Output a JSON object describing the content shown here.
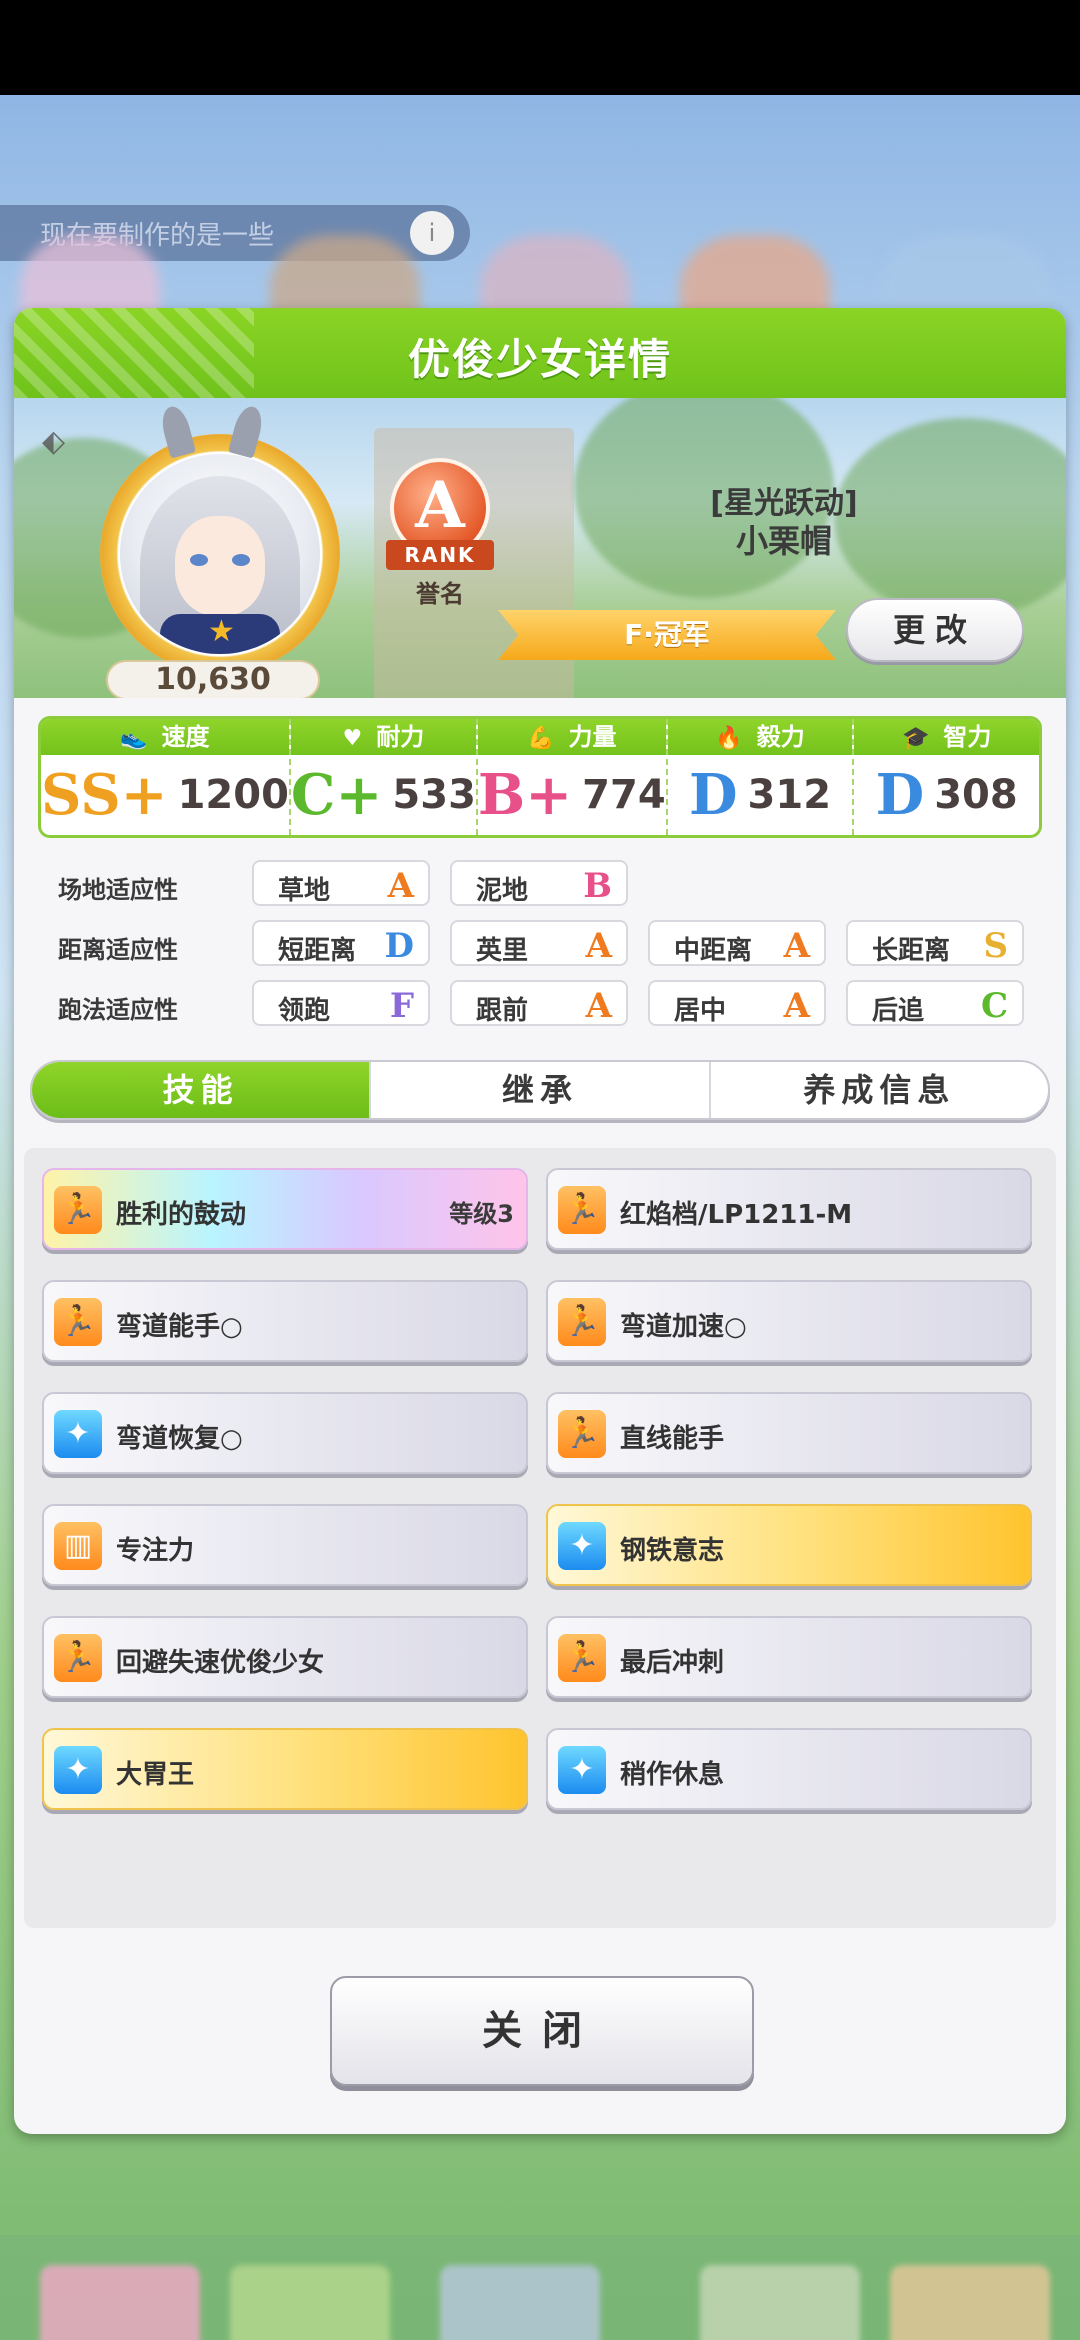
{
  "background": {
    "topbar_text": "现在要制作的是一些",
    "topbar_button": "i"
  },
  "modal": {
    "title": "优俊少女详情",
    "fan_count": "10,630",
    "rank": {
      "letter": "A",
      "ribbon": "RANK",
      "caption": "誉名"
    },
    "epithet": "[星光跃动]",
    "trainer_name": "小栗帽",
    "title_banner": "F·冠军",
    "change_button": "更改",
    "stats": [
      {
        "label": "速度",
        "icon": "shoe-icon",
        "grade": "SS+",
        "value": "1200",
        "color": "#f0a020"
      },
      {
        "label": "耐力",
        "icon": "heart-icon",
        "grade": "C+",
        "value": "533",
        "color": "#5cb82c"
      },
      {
        "label": "力量",
        "icon": "muscle-icon",
        "grade": "B+",
        "value": "774",
        "color": "#e8508a"
      },
      {
        "label": "毅力",
        "icon": "flame-icon",
        "grade": "D",
        "value": "312",
        "color": "#3a8ae0"
      },
      {
        "label": "智力",
        "icon": "mortarboard-icon",
        "grade": "D",
        "value": "308",
        "color": "#3a8ae0"
      }
    ],
    "aptitudes": {
      "track": {
        "label": "场地适应性",
        "items": [
          {
            "name": "草地",
            "grade": "A"
          },
          {
            "name": "泥地",
            "grade": "B"
          }
        ]
      },
      "distance": {
        "label": "距离适应性",
        "items": [
          {
            "name": "短距离",
            "grade": "D"
          },
          {
            "name": "英里",
            "grade": "A"
          },
          {
            "name": "中距离",
            "grade": "A"
          },
          {
            "name": "长距离",
            "grade": "S"
          }
        ]
      },
      "style": {
        "label": "跑法适应性",
        "items": [
          {
            "name": "领跑",
            "grade": "F"
          },
          {
            "name": "跟前",
            "grade": "A"
          },
          {
            "name": "居中",
            "grade": "A"
          },
          {
            "name": "后追",
            "grade": "C"
          }
        ]
      }
    },
    "grade_colors": {
      "S": "#e8b030",
      "A": "#f07a20",
      "B": "#e8508a",
      "C": "#5cb82c",
      "D": "#3a8ae0",
      "F": "#8a6ad8"
    },
    "tabs": [
      "技能",
      "继承",
      "养成信息"
    ],
    "skills": [
      {
        "name": "胜利的鼓动",
        "level": "等级3",
        "style": "rainbow",
        "icon": "runner-icon",
        "icon_color": "orange"
      },
      {
        "name": "红焰档/LP1211-M",
        "level": "",
        "style": "normal",
        "icon": "runner-icon",
        "icon_color": "orange"
      },
      {
        "name": "弯道能手○",
        "level": "",
        "style": "normal",
        "icon": "runner-icon",
        "icon_color": "orange"
      },
      {
        "name": "弯道加速○",
        "level": "",
        "style": "normal",
        "icon": "runner-icon",
        "icon_color": "orange"
      },
      {
        "name": "弯道恢复○",
        "level": "",
        "style": "normal",
        "icon": "sparkle-icon",
        "icon_color": "blue"
      },
      {
        "name": "直线能手",
        "level": "",
        "style": "normal",
        "icon": "runner-icon",
        "icon_color": "orange"
      },
      {
        "name": "专注力",
        "level": "",
        "style": "normal",
        "icon": "gate-icon",
        "icon_color": "orange"
      },
      {
        "name": "钢铁意志",
        "level": "",
        "style": "gold",
        "icon": "sparkle-icon",
        "icon_color": "blue"
      },
      {
        "name": "回避失速优俊少女",
        "level": "",
        "style": "normal",
        "icon": "runner-icon",
        "icon_color": "orange"
      },
      {
        "name": "最后冲刺",
        "level": "",
        "style": "normal",
        "icon": "runner-icon",
        "icon_color": "orange"
      },
      {
        "name": "大胃王",
        "level": "",
        "style": "gold",
        "icon": "sparkle-icon",
        "icon_color": "blue"
      },
      {
        "name": "稍作休息",
        "level": "",
        "style": "normal",
        "icon": "sparkle-icon",
        "icon_color": "blue"
      }
    ],
    "close_button": "关闭"
  }
}
